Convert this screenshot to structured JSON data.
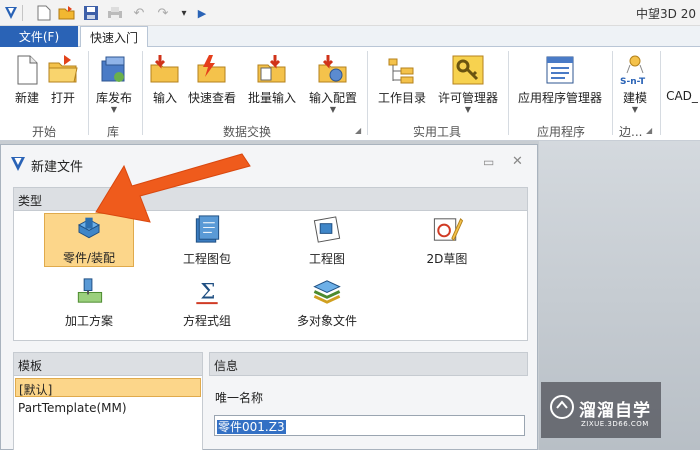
{
  "app": {
    "title": "中望3D 20"
  },
  "quick_access": [
    "app-logo-icon",
    "new-icon",
    "open-icon",
    "save-icon",
    "print-icon",
    "undo-icon",
    "redo-icon",
    "more-icon",
    "play-icon"
  ],
  "tabs": {
    "file": "文件(F)",
    "quick": "快速入门"
  },
  "ribbon": {
    "buttons": {
      "new": "新建",
      "open": "打开",
      "lib_publish": "库发布",
      "input": "输入",
      "fast_view": "快速查看",
      "batch_input": "批量输入",
      "input_config": "输入配置",
      "work_dir": "工作目录",
      "license": "许可管理器",
      "app_manager": "应用程序管理器",
      "modeling": "建模",
      "cad": "CAD_"
    },
    "groups": {
      "start": "开始",
      "library": "库",
      "data_exchange": "数据交换",
      "utilities": "实用工具",
      "applications": "应用程序",
      "edge": "边..."
    },
    "sn_t": "S-n-T"
  },
  "dialog": {
    "title": "新建文件",
    "type_header": "类型",
    "types": {
      "part": "零件/装配",
      "drawing_pack": "工程图包",
      "drawing": "工程图",
      "sketch2d": "2D草图",
      "cam": "加工方案",
      "equation": "方程式组",
      "multi": "多对象文件"
    },
    "template_header": "模板",
    "templates": {
      "default": "[默认]",
      "mm": "PartTemplate(MM)"
    },
    "info_header": "信息",
    "unique_name_label": "唯一名称",
    "unique_name_value": "零件001.Z3"
  },
  "watermark": {
    "name": "溜溜自学",
    "url": "ZIXUE.3D66.COM"
  },
  "colors": {
    "accent": "#2a63b6",
    "selected": "#fcd68a",
    "arrow": "#ef5b1c"
  }
}
